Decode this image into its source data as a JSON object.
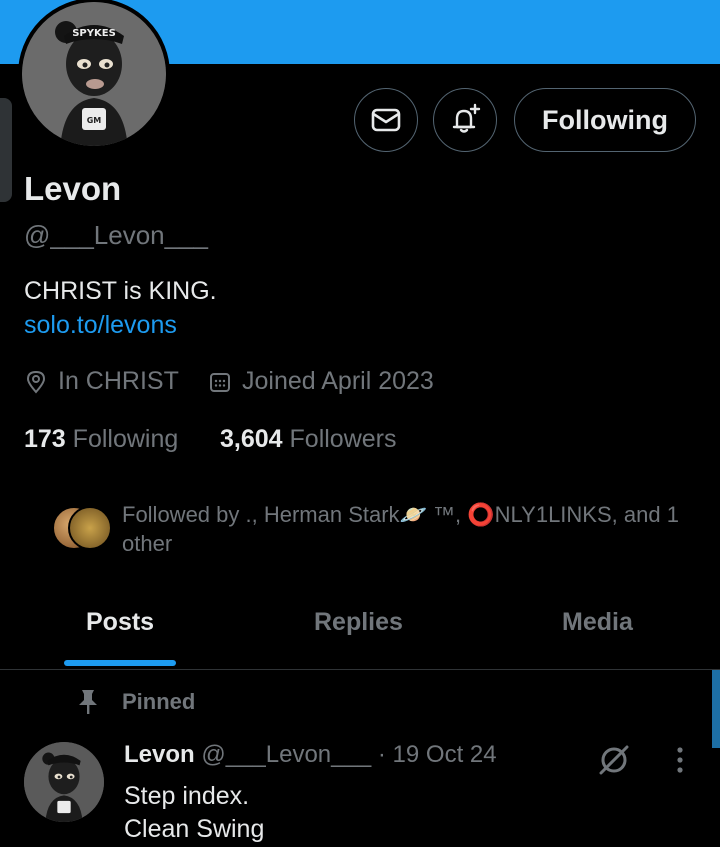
{
  "profile": {
    "name": "Levon",
    "handle": "@___Levon___",
    "bio": "CHRIST is KING.",
    "link": "solo.to/levons",
    "location": "In CHRIST",
    "joined": "Joined April 2023",
    "avatar_cap_text": "SPYKES",
    "avatar_mug_text": "GM"
  },
  "actions": {
    "message_icon": "mail-icon",
    "notify_icon": "bell-plus-icon",
    "follow_label": "Following"
  },
  "stats": {
    "following_count": "173",
    "following_label": "Following",
    "followers_count": "3,604",
    "followers_label": "Followers"
  },
  "followed_by": {
    "text": "Followed by ., Herman Stark🪐 ™, ⭕NLY1LINKS, and 1 other"
  },
  "tabs": [
    {
      "label": "Posts",
      "active": true
    },
    {
      "label": "Replies",
      "active": false
    },
    {
      "label": "Media",
      "active": false
    }
  ],
  "pinned_post": {
    "pinned_label": "Pinned",
    "author_name": "Levon",
    "author_handle": "@___Levon___",
    "date": "· 19 Oct 24",
    "line1": "Step index.",
    "line2": "Clean Swing"
  },
  "colors": {
    "accent": "#1d9bf0",
    "background": "#000000",
    "text_primary": "#e7e9ea",
    "text_secondary": "#71767b",
    "border": "#2f3336"
  }
}
